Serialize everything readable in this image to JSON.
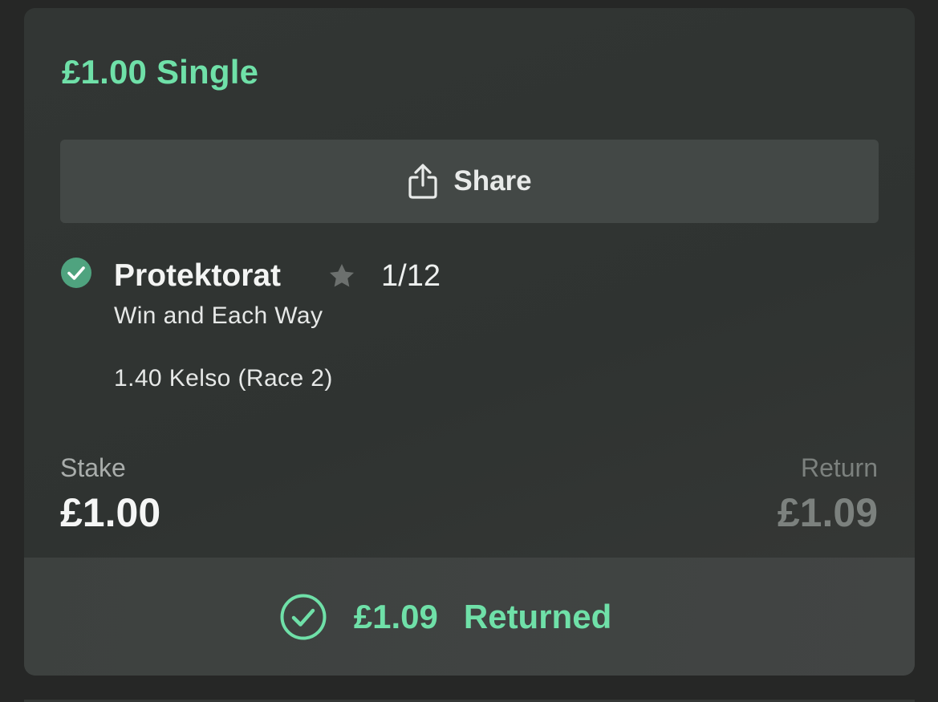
{
  "bet": {
    "title": "£1.00 Single"
  },
  "share": {
    "label": "Share",
    "icon": "share-icon"
  },
  "selection": {
    "status_icon": "check-circle-icon",
    "name": "Protektorat",
    "favourite_icon": "star-icon",
    "odds": "1/12",
    "market": "Win and Each Way",
    "event": "1.40 Kelso (Race 2)"
  },
  "stake": {
    "label": "Stake",
    "value": "£1.00"
  },
  "return": {
    "label": "Return",
    "value": "£1.09"
  },
  "result": {
    "icon": "check-circle-outline-icon",
    "amount": "£1.09",
    "text": "Returned"
  },
  "colors": {
    "accent": "#6fe0a8",
    "status_check": "#4fa37f",
    "background": "#262726",
    "card": "#323634",
    "share_button": "#434846",
    "muted_text": "#7c817e"
  }
}
